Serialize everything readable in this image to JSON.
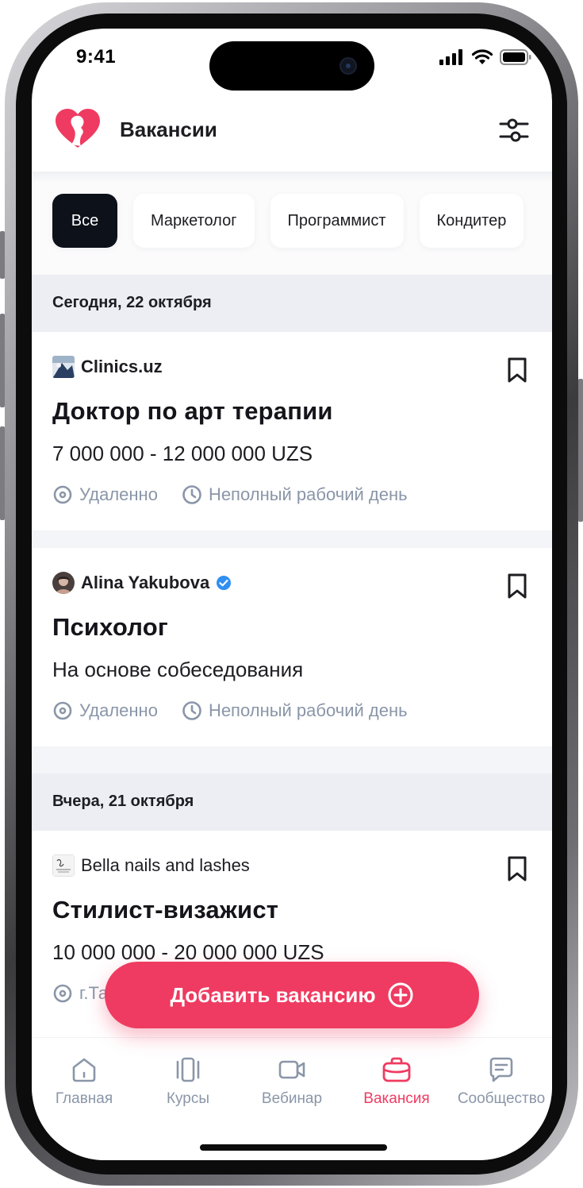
{
  "status": {
    "time": "9:41"
  },
  "header": {
    "title": "Вакансии"
  },
  "chips": [
    "Все",
    "Маркетолог",
    "Программист",
    "Кондитер"
  ],
  "sections": [
    {
      "date": "Сегодня, 22 октября",
      "jobs": [
        {
          "company": "Clinics.uz",
          "title": "Доктор по арт терапии",
          "salary": "7 000 000 - 12 000 000 UZS",
          "location": "Удаленно",
          "schedule": "Неполный рабочий день"
        },
        {
          "company": "Alina Yakubova",
          "verified": true,
          "title": "Психолог",
          "salary": "На основе собеседования",
          "location": "Удаленно",
          "schedule": "Неполный рабочий день"
        }
      ]
    },
    {
      "date": "Вчера, 21 октября",
      "jobs": [
        {
          "company": "Bella nails and lashes",
          "title": "Стилист-визажист",
          "salary": "10 000 000 - 20 000 000 UZS",
          "location": "г.Та"
        }
      ]
    }
  ],
  "fab": {
    "label": "Добавить вакансию"
  },
  "tabbar": [
    {
      "label": "Главная",
      "icon": "home-icon"
    },
    {
      "label": "Курсы",
      "icon": "courses-icon"
    },
    {
      "label": "Вебинар",
      "icon": "video-icon"
    },
    {
      "label": "Вакансия",
      "icon": "briefcase-icon",
      "active": true
    },
    {
      "label": "Сообщество",
      "icon": "chat-icon"
    }
  ],
  "colors": {
    "accent": "#ef3b61",
    "dark": "#0d111a",
    "muted": "#8a96a8",
    "section_bg": "#eceef3",
    "verified": "#2f8ff2"
  }
}
